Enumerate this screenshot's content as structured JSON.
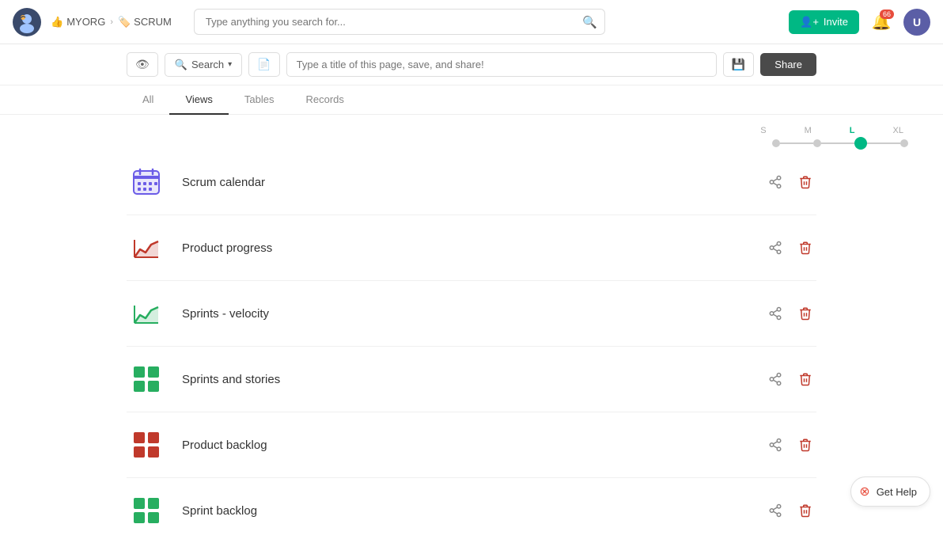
{
  "header": {
    "org_name": "MYORG",
    "scrum_name": "SCRUM",
    "search_placeholder": "Type anything you search for...",
    "invite_label": "Invite",
    "notif_count": "66",
    "user_initial": "U"
  },
  "toolbar": {
    "search_label": "Search",
    "title_placeholder": "Type a title of this page, save, and share!",
    "share_label": "Share"
  },
  "tabs": {
    "all": "All",
    "views": "Views",
    "tables": "Tables",
    "records": "Records",
    "active": "Views"
  },
  "size_selector": {
    "options": [
      "S",
      "M",
      "L",
      "XL"
    ],
    "active": "L"
  },
  "views": [
    {
      "id": "scrum-calendar",
      "name": "Scrum calendar",
      "icon_type": "calendar",
      "icon_color": "#6b5ce7"
    },
    {
      "id": "product-progress",
      "name": "Product progress",
      "icon_type": "area-chart",
      "icon_color": "#c0392b"
    },
    {
      "id": "sprints-velocity",
      "name": "Sprints - velocity",
      "icon_type": "area-chart",
      "icon_color": "#27ae60"
    },
    {
      "id": "sprints-stories",
      "name": "Sprints and stories",
      "icon_type": "grid",
      "icon_color": "#27ae60"
    },
    {
      "id": "product-backlog",
      "name": "Product backlog",
      "icon_type": "grid",
      "icon_color": "#c0392b"
    },
    {
      "id": "sprint-backlog",
      "name": "Sprint backlog",
      "icon_type": "grid",
      "icon_color": "#27ae60"
    }
  ],
  "help": {
    "label": "Get Help"
  }
}
